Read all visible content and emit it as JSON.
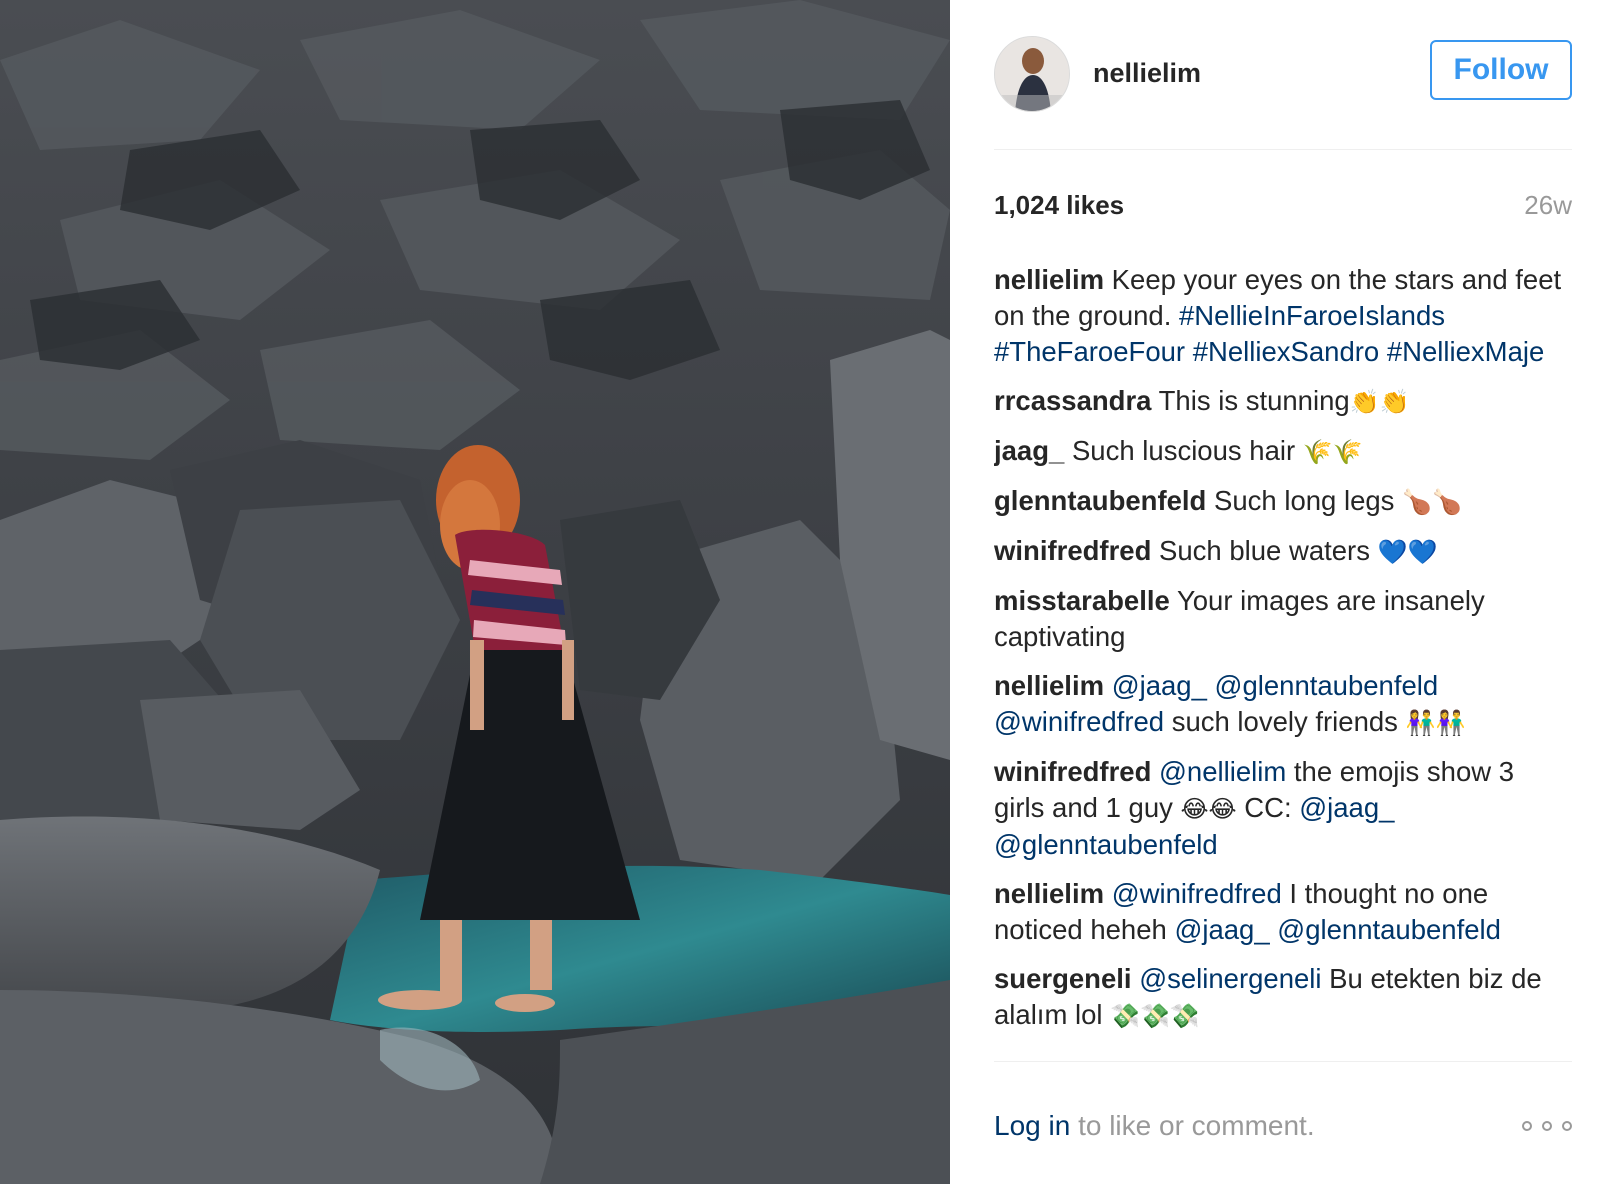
{
  "post": {
    "username": "nellielim",
    "follow_label": "Follow",
    "likes": "1,024 likes",
    "age": "26w"
  },
  "comments": [
    {
      "author": "nellielim",
      "segments": [
        {
          "text": " Keep your eyes on the stars and feet on the ground. "
        },
        {
          "text": "#NellieInFaroeIslands",
          "tag": true
        },
        {
          "text": " "
        },
        {
          "text": "#TheFaroeFour",
          "tag": true
        },
        {
          "text": " "
        },
        {
          "text": "#NelliexSandro",
          "tag": true
        },
        {
          "text": " "
        },
        {
          "text": "#NelliexMaje",
          "tag": true
        }
      ]
    },
    {
      "author": "rrcassandra",
      "segments": [
        {
          "text": " This is stunning"
        },
        {
          "text": "👏👏",
          "emoji": true
        }
      ]
    },
    {
      "author": "jaag_",
      "segments": [
        {
          "text": " Such luscious hair "
        },
        {
          "text": "🌾🌾",
          "emoji": true
        }
      ]
    },
    {
      "author": "glenntaubenfeld",
      "segments": [
        {
          "text": " Such long legs "
        },
        {
          "text": "🍗🍗",
          "emoji": true
        }
      ]
    },
    {
      "author": "winifredfred",
      "segments": [
        {
          "text": " Such blue waters "
        },
        {
          "text": "💙💙",
          "emoji": true
        }
      ]
    },
    {
      "author": "misstarabelle",
      "segments": [
        {
          "text": " Your images are insanely captivating"
        }
      ]
    },
    {
      "author": "nellielim",
      "segments": [
        {
          "text": " "
        },
        {
          "text": "@jaag_",
          "tag": true
        },
        {
          "text": " "
        },
        {
          "text": "@glenntaubenfeld",
          "tag": true
        },
        {
          "text": " "
        },
        {
          "text": "@winifredfred",
          "tag": true
        },
        {
          "text": " such lovely friends "
        },
        {
          "text": "👫👫",
          "emoji": true
        }
      ]
    },
    {
      "author": "winifredfred",
      "segments": [
        {
          "text": " "
        },
        {
          "text": "@nellielim",
          "tag": true
        },
        {
          "text": " the emojis show 3 girls and 1 guy "
        },
        {
          "text": "😂😂",
          "emoji": true
        },
        {
          "text": " CC: "
        },
        {
          "text": "@jaag_",
          "tag": true
        },
        {
          "text": " "
        },
        {
          "text": "@glenntaubenfeld",
          "tag": true
        }
      ]
    },
    {
      "author": "nellielim",
      "segments": [
        {
          "text": " "
        },
        {
          "text": "@winifredfred",
          "tag": true
        },
        {
          "text": " I thought no one noticed heheh "
        },
        {
          "text": "@jaag_",
          "tag": true
        },
        {
          "text": " "
        },
        {
          "text": "@glenntaubenfeld",
          "tag": true
        }
      ]
    },
    {
      "author": "suergeneli",
      "segments": [
        {
          "text": " "
        },
        {
          "text": "@selinergeneli",
          "tag": true
        },
        {
          "text": " Bu etekten biz de alalım lol "
        },
        {
          "text": "💸💸💸",
          "emoji": true
        }
      ]
    }
  ],
  "footer": {
    "login_link": "Log in",
    "login_rest": " to like or comment."
  },
  "colors": {
    "follow_blue": "#3897f0",
    "link_blue": "#003569",
    "muted_gray": "#999999",
    "text": "#262626"
  },
  "icons": {
    "more_options": "three-dots-icon"
  }
}
